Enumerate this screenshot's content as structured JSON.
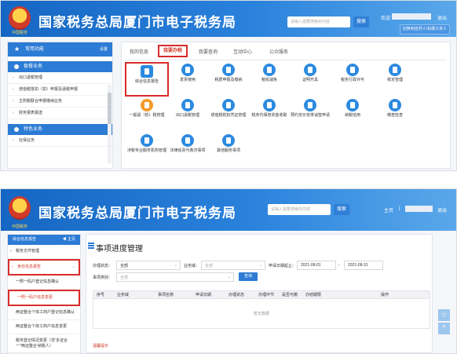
{
  "site_title": "国家税务总局厦门市电子税务局",
  "logo_sub": "中国税务",
  "shot1": {
    "search_placeholder": "请输入需要搜索的内容",
    "search_btn": "搜索",
    "welcome": "欢迎",
    "logout": "退出",
    "switch_btn": "切换到自然人/扣缴义务人",
    "left": {
      "header": "常用功能",
      "settings": "设置",
      "section1": "套餐业务",
      "items": [
        "出口退税管理",
        "增值税抵扣（扣）申报及退税申报",
        "主附税联合申报缴纳业务",
        "财务报表报送"
      ],
      "section2": "特色业务",
      "items2": [
        "社保业务"
      ]
    },
    "tabs": [
      "我的信息",
      "我要办税",
      "我要查询",
      "互动中心",
      "公众服务"
    ],
    "tiles": [
      "综合信息报告",
      "发票使用",
      "税费申报及缴纳",
      "税收减免",
      "证明开具",
      "税务行政许可",
      "核定管理",
      "一般退（抵）税管理",
      "出口退税管理",
      "增值税抵扣凭证管理",
      "税务代保管资金收取",
      "预约定价安排谈签申请",
      "纳税信用",
      "稽查检查",
      "涉税专业服务机构管理",
      "法律追责与救济事项",
      "其他服务事项"
    ]
  },
  "shot2": {
    "search_placeholder": "请输入需要搜索的内容",
    "search_btn": "搜索",
    "home": "主页",
    "sep": "|",
    "logout": "退出",
    "left": {
      "header": "综合信息报告",
      "back": "◀ 主页",
      "items": [
        "税务文件管理",
        "身份信息报告",
        "一照一码户登记信息确认",
        "一照一码户信息变更",
        "两证整合个体工商户登记信息确认",
        "两证整合个体工商户信息变更",
        "税务登记情况变更（非'多证合一''两证整合'纳税人）"
      ]
    },
    "page_title": "事项进度管理",
    "filters": {
      "office_label": "办理状态：",
      "office_value": "全部",
      "center_label": "业务域：",
      "center_value": "全部",
      "date_label": "申请日期起止：",
      "date_from": "2021-08-01",
      "date_sep": "-",
      "date_to": "2021-08-31",
      "type_label": "事项类别：",
      "type_value": "全部",
      "query_btn": "查询"
    },
    "columns": [
      "序号",
      "业务域",
      "事项名称",
      "申请日期",
      "办理状态",
      "办理环节",
      "是否可撤",
      "办结期限",
      "操作"
    ],
    "empty": "暂无数据",
    "note": "温馨提示"
  },
  "colors": {
    "brand_blue": "#2c7bd4",
    "highlight_red": "#d92b2b"
  }
}
